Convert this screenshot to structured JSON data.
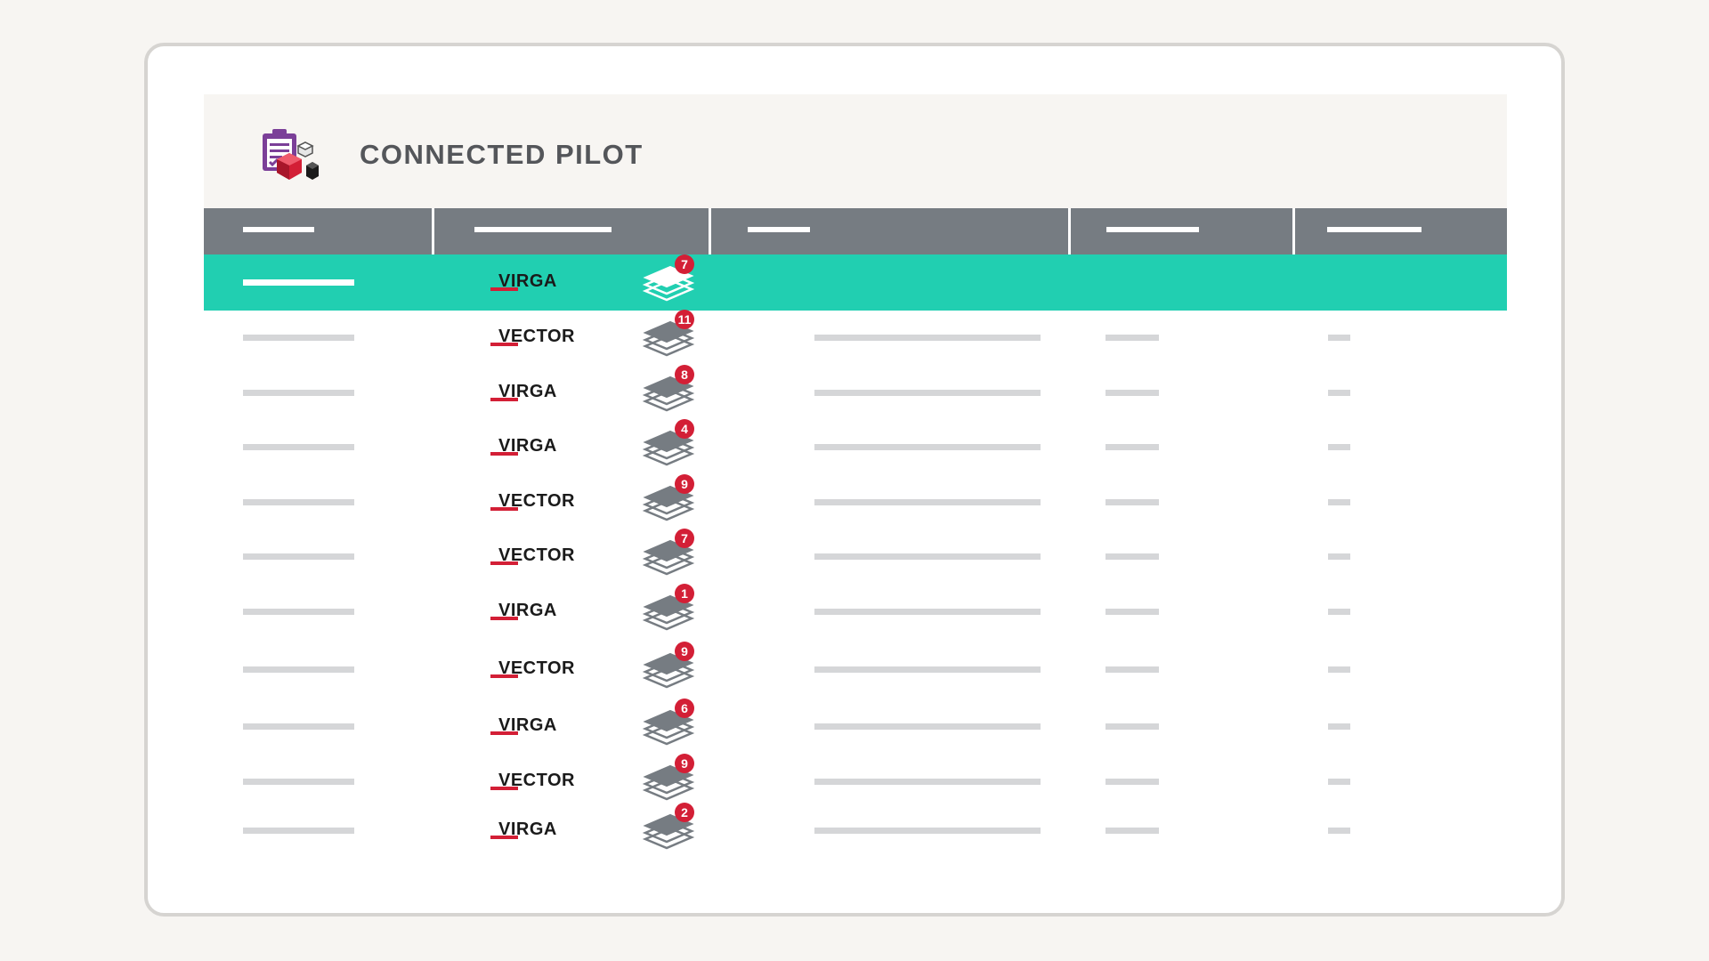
{
  "app": {
    "title": "CONNECTED PILOT",
    "logo_icon": "clipboard-cubes-logo-icon"
  },
  "colors": {
    "header_bar": "#767c82",
    "selected_row": "#21cfb1",
    "accent_red": "#d31f36",
    "logo_purple": "#7b3f98"
  },
  "table": {
    "column_count": 5,
    "rows": [
      {
        "name": "VIRGA",
        "count": "7",
        "selected": true
      },
      {
        "name": "VECTOR",
        "count": "11",
        "selected": false
      },
      {
        "name": "VIRGA",
        "count": "8",
        "selected": false
      },
      {
        "name": "VIRGA",
        "count": "4",
        "selected": false
      },
      {
        "name": "VECTOR",
        "count": "9",
        "selected": false
      },
      {
        "name": "VECTOR",
        "count": "7",
        "selected": false
      },
      {
        "name": "VIRGA",
        "count": "1",
        "selected": false
      },
      {
        "name": "VECTOR",
        "count": "9",
        "selected": false
      },
      {
        "name": "VIRGA",
        "count": "6",
        "selected": false
      },
      {
        "name": "VECTOR",
        "count": "9",
        "selected": false
      },
      {
        "name": "VIRGA",
        "count": "2",
        "selected": false
      }
    ]
  },
  "icons": {
    "row_stack": "layers-stack-icon",
    "row_badge": "count-badge"
  }
}
